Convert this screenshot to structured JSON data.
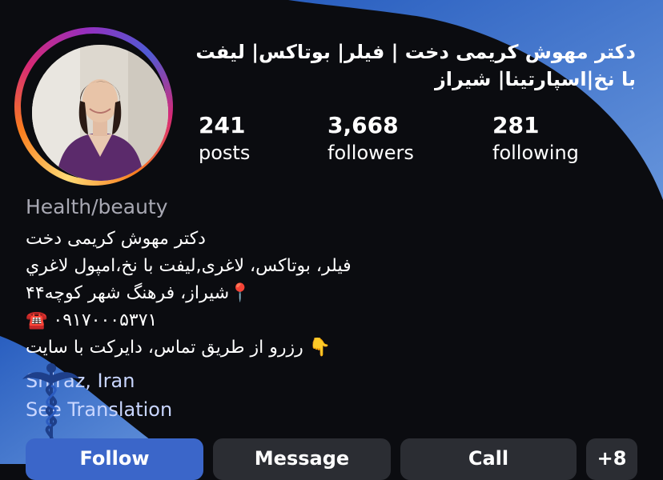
{
  "profile": {
    "name": "دکتر مهوش کریمی دخت | فیلر| بوتاکس| لیفت با نخ|اسپارتینا| شیراز",
    "stats": [
      {
        "value": "241",
        "label": "posts"
      },
      {
        "value": "3,668",
        "label": "followers"
      },
      {
        "value": "281",
        "label": "following"
      }
    ],
    "category": "Health/beauty",
    "bio": [
      "دکتر مهوش کریمی دخت",
      "فیلر، بوتاکس، لاغری,لیفت با نخ،امپول لاغري",
      "📍شیراز، فرهنگ شهر کوچه۴۴",
      "☎️ ۰۹۱۷۰۰۰۵۳۷۱",
      "👇 رزرو از طریق تماس، دایرکت با سایت"
    ],
    "links": [
      "Shiraz, Iran",
      "See Translation"
    ]
  },
  "actions": {
    "follow": "Follow",
    "message": "Message",
    "call": "Call",
    "more": "+8"
  },
  "colors": {
    "background": "#0b0c10",
    "wave_blue": "#3f6fc4",
    "button_bg": "#2b2d33"
  }
}
